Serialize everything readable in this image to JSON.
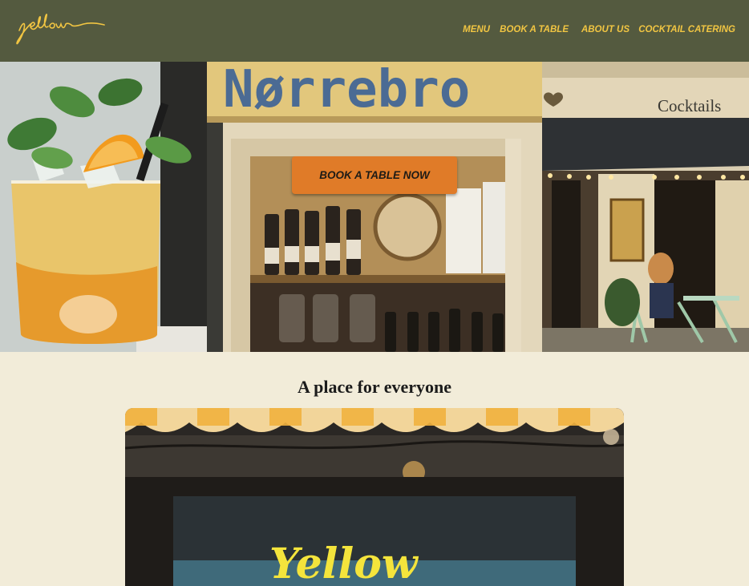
{
  "header": {
    "logo_text": "Yellow",
    "nav": [
      {
        "label": "MENU"
      },
      {
        "label": "BOOK A TABLE"
      },
      {
        "label": "ABOUT US"
      },
      {
        "label": "COCKTAIL CATERING"
      }
    ]
  },
  "hero": {
    "sign_text": "Nørrebro",
    "shop_sign_text": "Cocktails",
    "cta_label": "BOOK A TABLE NOW"
  },
  "section": {
    "title": "A place for everyone",
    "neon_text": "Yellow"
  },
  "colors": {
    "header_bg": "#545a3f",
    "nav_text": "#f1c542",
    "page_bg": "#f2ecd9",
    "cta_bg": "#e07b28"
  }
}
